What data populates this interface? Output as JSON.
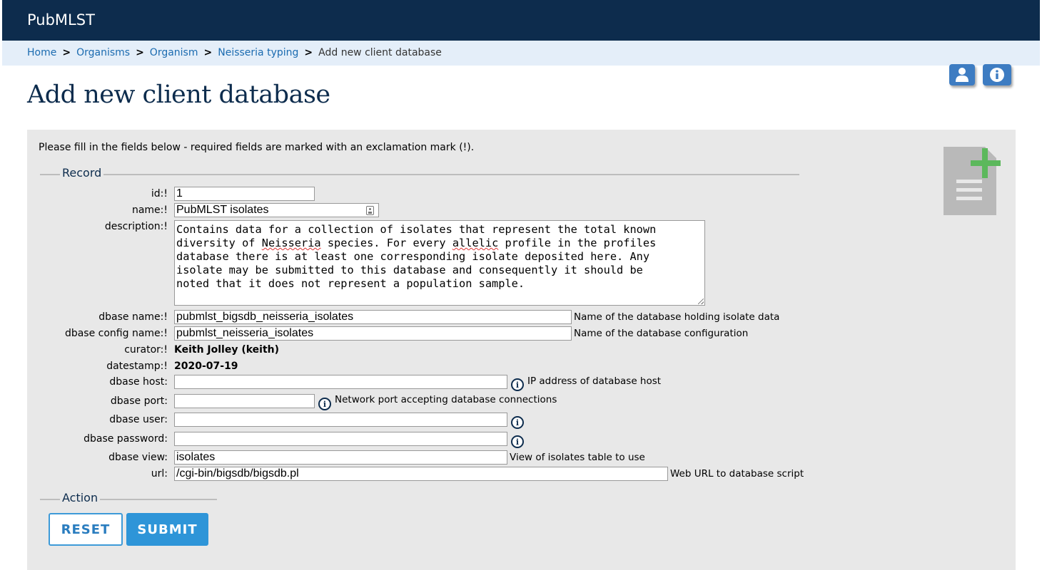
{
  "header": {
    "brand": "PubMLST"
  },
  "breadcrumb": {
    "items": [
      "Home",
      "Organisms",
      "Organism",
      "Neisseria typing"
    ],
    "separator": ">",
    "current": "Add new client database"
  },
  "page": {
    "title": "Add new client database"
  },
  "form": {
    "intro": "Please fill in the fields below - required fields are marked with an exclamation mark (!).",
    "record_legend": "Record",
    "action_legend": "Action",
    "fields": {
      "id": {
        "label": "id:!",
        "value": "1"
      },
      "name": {
        "label": "name:!",
        "value": "PubMLST isolates"
      },
      "description": {
        "label": "description:!",
        "lines": [
          "Contains data for a collection of isolates that represent the total known",
          "diversity of ",
          "Neisseria",
          " species. For every ",
          "allelic",
          " profile in the profiles",
          "database there is at least one corresponding isolate deposited here. Any",
          "isolate may be submitted to this database and consequently it should be",
          "noted that it does not represent a population sample."
        ]
      },
      "dbase_name": {
        "label": "dbase name:!",
        "value": "pubmlst_bigsdb_neisseria_isolates",
        "help": "Name of the database holding isolate data"
      },
      "dbase_config_name": {
        "label": "dbase config name:!",
        "value": "pubmlst_neisseria_isolates",
        "help": "Name of the database configuration"
      },
      "curator": {
        "label": "curator:!",
        "value": "Keith Jolley (keith)"
      },
      "datestamp": {
        "label": "datestamp:!",
        "value": "2020-07-19"
      },
      "dbase_host": {
        "label": "dbase host:",
        "value": "",
        "help": "IP address of database host"
      },
      "dbase_port": {
        "label": "dbase port:",
        "value": "",
        "help": "Network port accepting database connections"
      },
      "dbase_user": {
        "label": "dbase user:",
        "value": ""
      },
      "dbase_password": {
        "label": "dbase password:",
        "value": ""
      },
      "dbase_view": {
        "label": "dbase view:",
        "value": "isolates",
        "help": "View of isolates table to use"
      },
      "url": {
        "label": "url:",
        "value": "/cgi-bin/bigsdb/bigsdb.pl",
        "help": "Web URL to database script"
      }
    },
    "buttons": {
      "reset": "RESET",
      "submit": "SUBMIT"
    }
  },
  "icons": {
    "user": "user-icon",
    "info": "info-icon",
    "add_document": "add-document-icon",
    "field_help": "info-circle-icon"
  },
  "colors": {
    "header_bg": "#0d2c4d",
    "breadcrumb_bg": "#e4eef9",
    "link": "#1b6bb0",
    "panel_bg": "#e8e8e8",
    "submit_bg": "#2e95d8",
    "add_icon": "#5cb85c"
  }
}
